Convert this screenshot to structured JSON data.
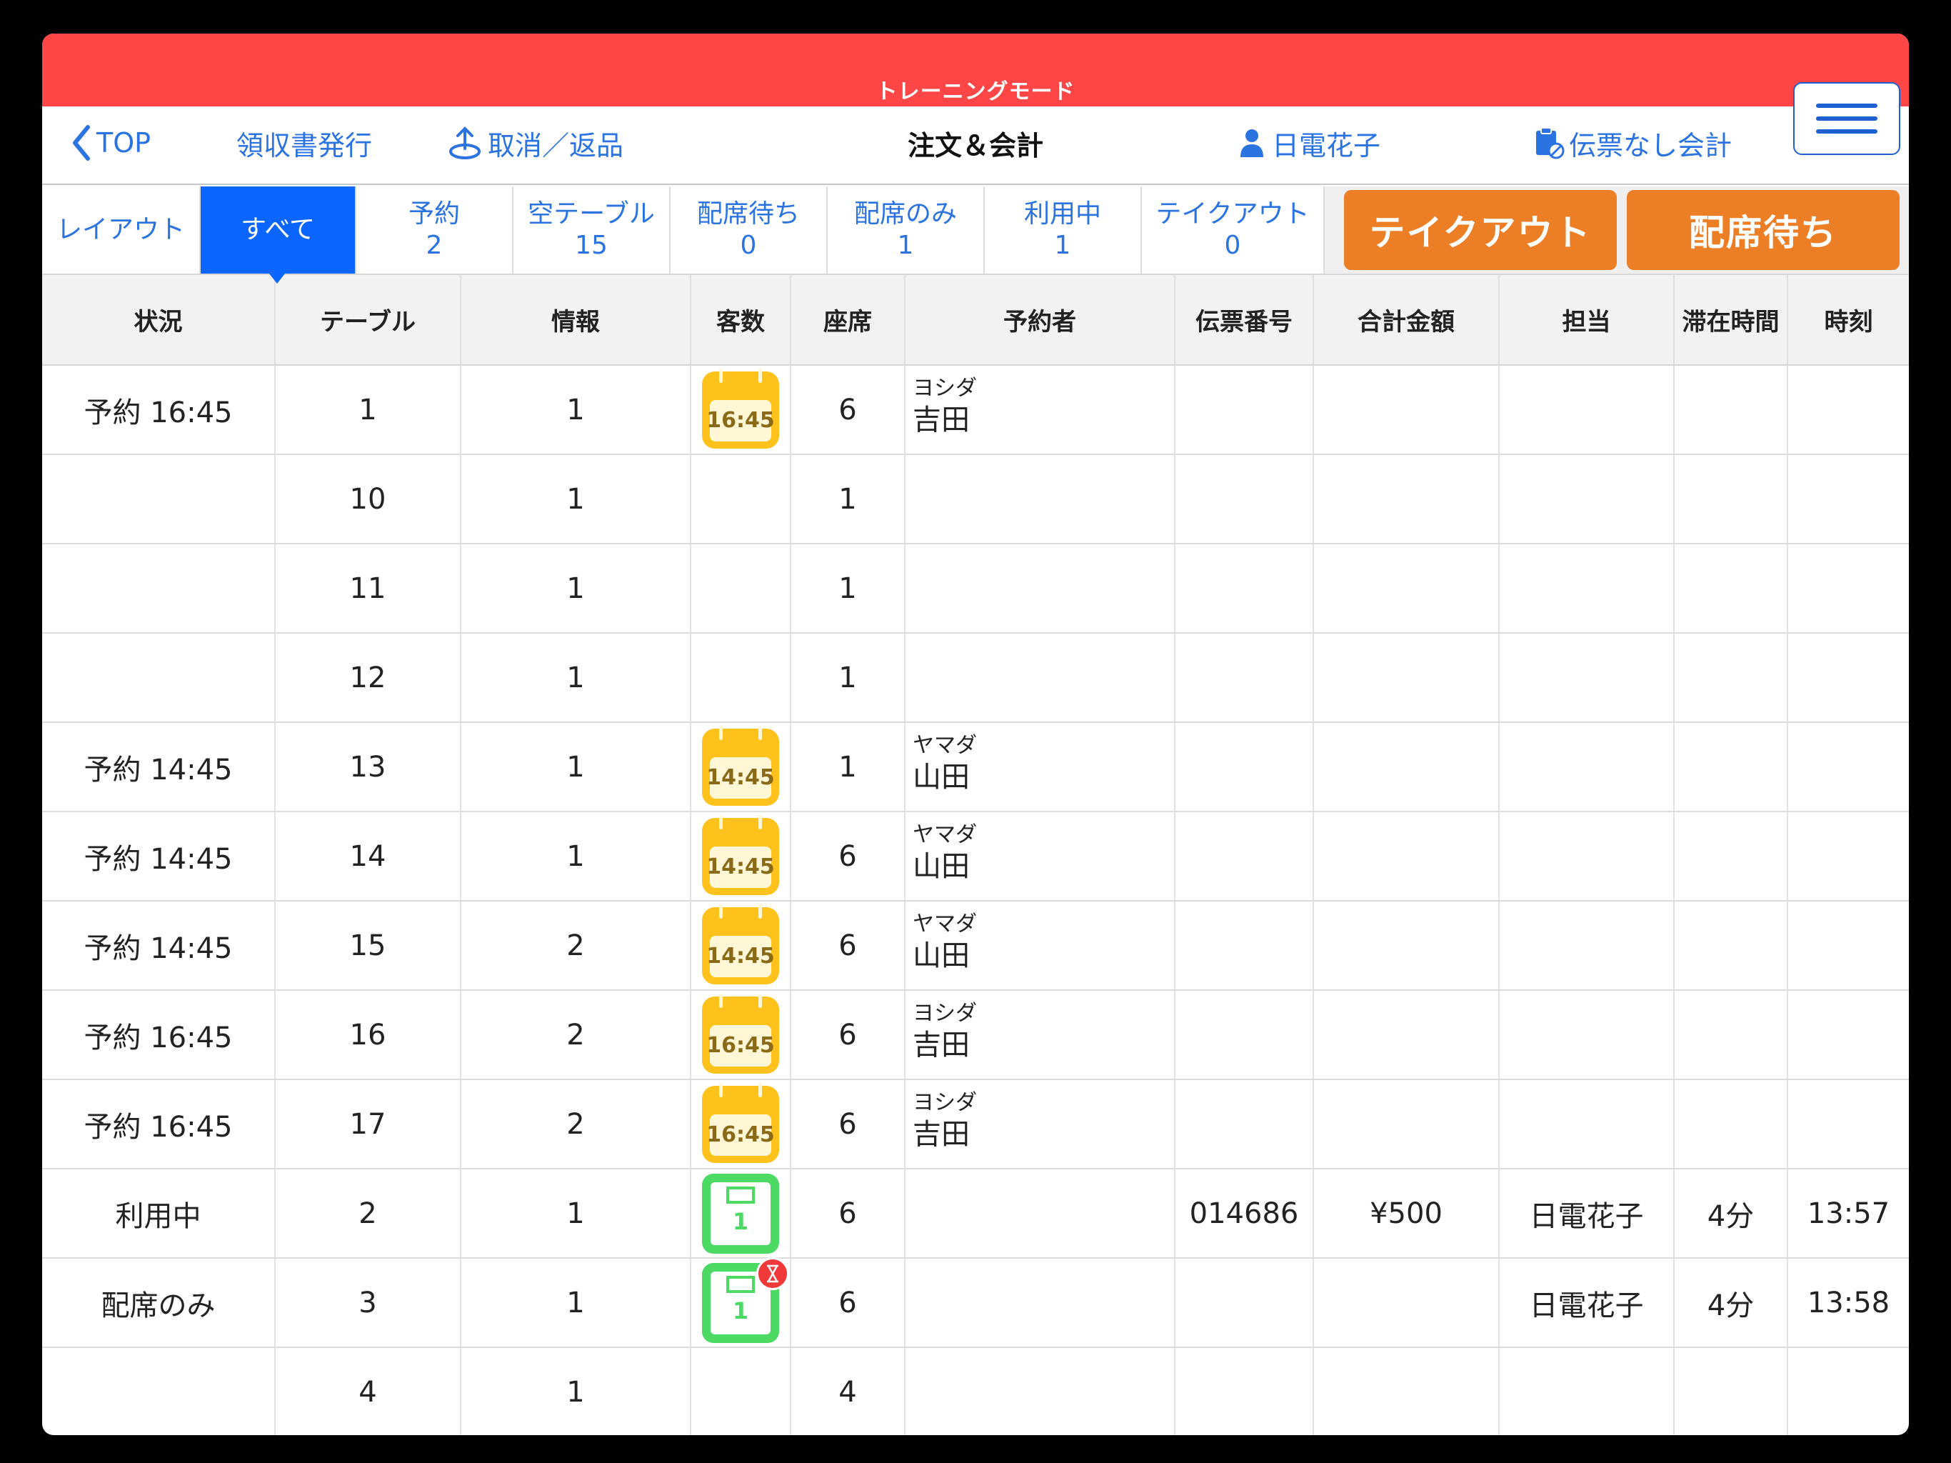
{
  "banner": {
    "training": "トレーニングモード"
  },
  "nav": {
    "back": "TOP",
    "receipt": "領収書発行",
    "cancel": "取消／返品",
    "title": "注文＆会計",
    "user": "日電花子",
    "no_slip": "伝票なし会計"
  },
  "tabs": [
    {
      "label": "レイアウト"
    },
    {
      "label": "すべて"
    },
    {
      "label": "予約",
      "count": "2"
    },
    {
      "label": "空テーブル",
      "count": "15"
    },
    {
      "label": "配席待ち",
      "count": "0"
    },
    {
      "label": "配席のみ",
      "count": "1"
    },
    {
      "label": "利用中",
      "count": "1"
    },
    {
      "label": "テイクアウト",
      "count": "0"
    }
  ],
  "buttons": {
    "takeout": "テイクアウト",
    "waiting": "配席待ち"
  },
  "columns": [
    "状況",
    "テーブル",
    "情報",
    "客数",
    "座席",
    "予約者",
    "伝票番号",
    "合計金額",
    "担当",
    "滞在時間",
    "時刻"
  ],
  "rows": [
    {
      "status": "予約 16:45",
      "table": "1",
      "info": "1",
      "icon": "16:45",
      "seats": "6",
      "kana": "ヨシダ",
      "name": "吉田",
      "slip": "",
      "total": "",
      "staff": "",
      "stay": "",
      "time": ""
    },
    {
      "status": "",
      "table": "10",
      "info": "1",
      "icon": "",
      "seats": "1",
      "kana": "",
      "name": "",
      "slip": "",
      "total": "",
      "staff": "",
      "stay": "",
      "time": ""
    },
    {
      "status": "",
      "table": "11",
      "info": "1",
      "icon": "",
      "seats": "1",
      "kana": "",
      "name": "",
      "slip": "",
      "total": "",
      "staff": "",
      "stay": "",
      "time": ""
    },
    {
      "status": "",
      "table": "12",
      "info": "1",
      "icon": "",
      "seats": "1",
      "kana": "",
      "name": "",
      "slip": "",
      "total": "",
      "staff": "",
      "stay": "",
      "time": ""
    },
    {
      "status": "予約 14:45",
      "table": "13",
      "info": "1",
      "icon": "14:45",
      "seats": "1",
      "kana": "ヤマダ",
      "name": "山田",
      "slip": "",
      "total": "",
      "staff": "",
      "stay": "",
      "time": ""
    },
    {
      "status": "予約 14:45",
      "table": "14",
      "info": "1",
      "icon": "14:45",
      "seats": "6",
      "kana": "ヤマダ",
      "name": "山田",
      "slip": "",
      "total": "",
      "staff": "",
      "stay": "",
      "time": ""
    },
    {
      "status": "予約 14:45",
      "table": "15",
      "info": "2",
      "icon": "14:45",
      "seats": "6",
      "kana": "ヤマダ",
      "name": "山田",
      "slip": "",
      "total": "",
      "staff": "",
      "stay": "",
      "time": ""
    },
    {
      "status": "予約 16:45",
      "table": "16",
      "info": "2",
      "icon": "16:45",
      "seats": "6",
      "kana": "ヨシダ",
      "name": "吉田",
      "slip": "",
      "total": "",
      "staff": "",
      "stay": "",
      "time": ""
    },
    {
      "status": "予約 16:45",
      "table": "17",
      "info": "2",
      "icon": "16:45",
      "seats": "6",
      "kana": "ヨシダ",
      "name": "吉田",
      "slip": "",
      "total": "",
      "staff": "",
      "stay": "",
      "time": ""
    },
    {
      "status": "利用中",
      "table": "2",
      "info": "1",
      "slip_icon": "1",
      "seats": "6",
      "kana": "",
      "name": "",
      "slip": "014686",
      "total": "¥500",
      "staff": "日電花子",
      "stay": "4分",
      "time": "13:57"
    },
    {
      "status": "配席のみ",
      "table": "3",
      "info": "1",
      "slip_icon": "1",
      "hourglass": true,
      "seats": "6",
      "kana": "",
      "name": "",
      "slip": "",
      "total": "",
      "staff": "日電花子",
      "stay": "4分",
      "time": "13:58"
    },
    {
      "status": "",
      "table": "4",
      "info": "1",
      "icon": "",
      "seats": "4",
      "kana": "",
      "name": "",
      "slip": "",
      "total": "",
      "staff": "",
      "stay": "",
      "time": ""
    },
    {
      "status": "",
      "table": "",
      "info": "",
      "icon": "",
      "seats": "",
      "kana": "",
      "name": "",
      "slip": "",
      "total": "",
      "staff": "",
      "stay": "",
      "time": ""
    }
  ],
  "colors": {
    "banner": "#ff4646",
    "accent": "#2a73e0",
    "active_tab": "#0a66ff",
    "orange": "#ec7e25",
    "calendar": "#ffc21c",
    "slip": "#4cd964"
  }
}
